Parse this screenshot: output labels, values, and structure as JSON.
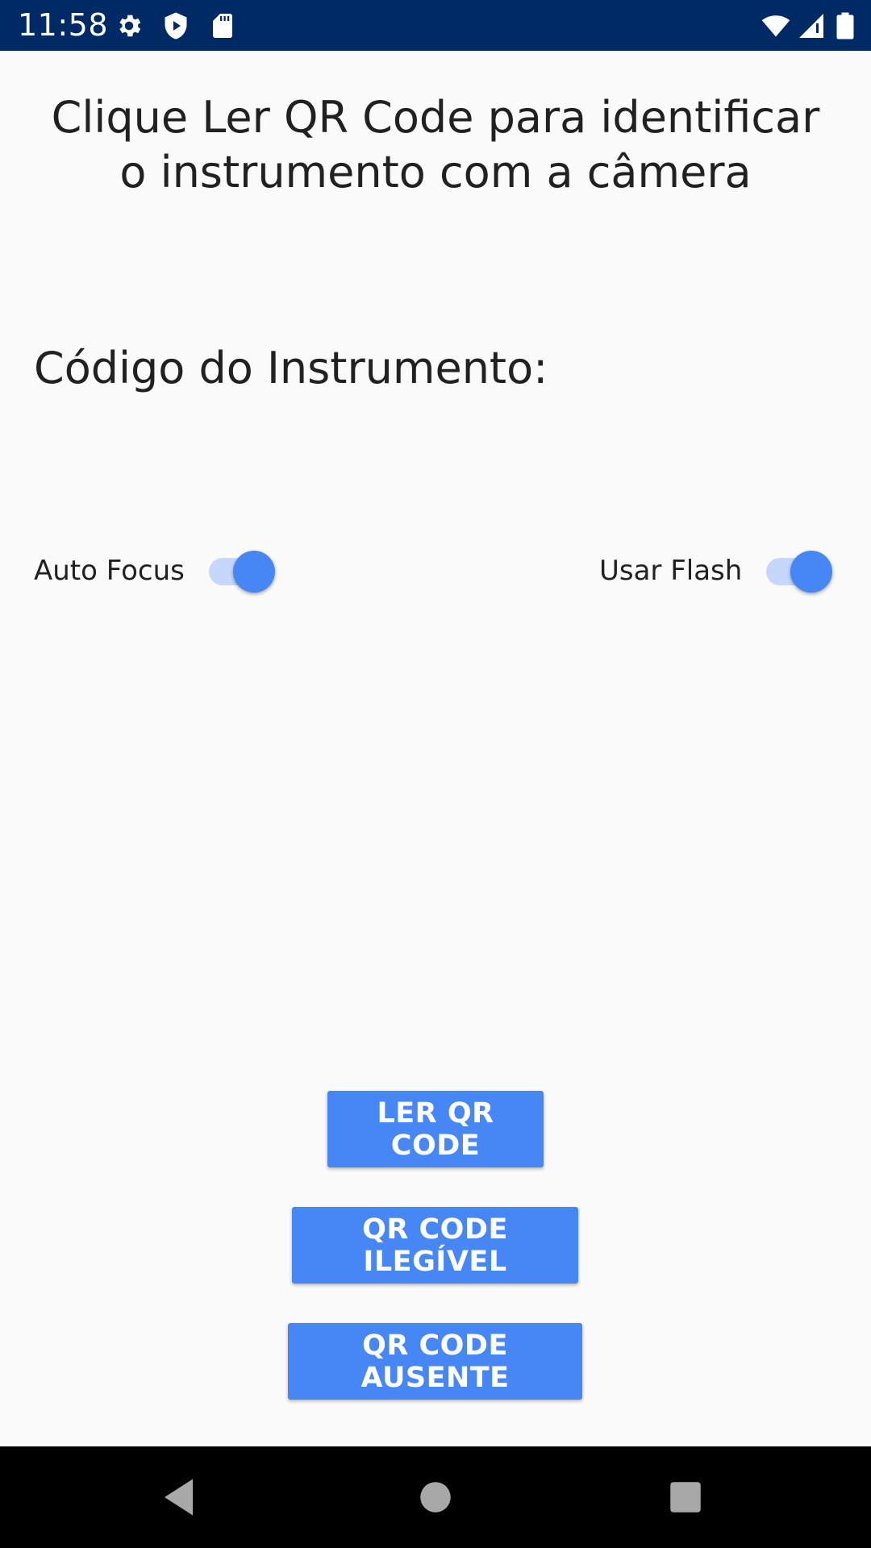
{
  "status_bar": {
    "time": "11:58",
    "icons": [
      "settings-icon",
      "shield-icon",
      "sd-card-icon",
      "wifi-icon",
      "signal-icon",
      "battery-icon"
    ],
    "background": "#002a66"
  },
  "main": {
    "instruction": "Clique Ler QR Code para identificar o instrumento com a câmera",
    "code_label": "Código do Instrumento:",
    "auto_focus": {
      "label": "Auto Focus",
      "checked": true
    },
    "use_flash": {
      "label": "Usar Flash",
      "checked": true
    },
    "buttons": {
      "read_qr": "LER QR CODE",
      "qr_illegible": "QR CODE ILEGÍVEL",
      "qr_missing": "QR CODE AUSENTE"
    }
  },
  "nav_bar": {
    "icons": [
      "back-icon",
      "home-icon",
      "recents-icon"
    ]
  },
  "colors": {
    "accent": "#4687f5",
    "switch_track": "#c5d8fb",
    "background": "#fafafa",
    "text": "#212121"
  }
}
